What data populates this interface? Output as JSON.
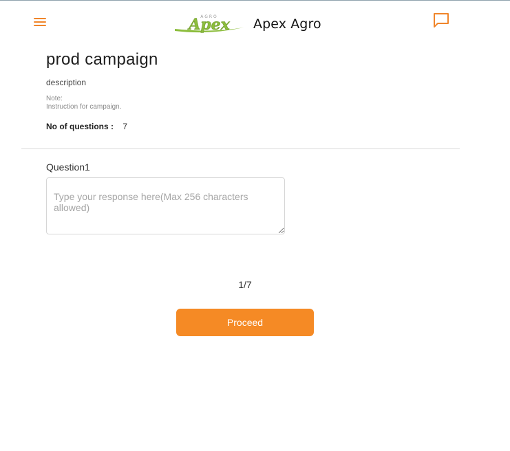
{
  "header": {
    "menu_icon": "menu-icon",
    "chat_icon": "chat-icon",
    "logo_text": "Apex",
    "logo_small_text": "AGRO",
    "app_name": "Apex Agro"
  },
  "campaign": {
    "title": "prod campaign",
    "description": "description",
    "note_label": "Note:",
    "note_text": "Instruction for campaign.",
    "questions_label": "No of questions :",
    "questions_count": "7"
  },
  "question": {
    "label": "Question1",
    "value": "",
    "placeholder": "Type your response here(Max 256 characters allowed)"
  },
  "pager": {
    "text": "1/7"
  },
  "actions": {
    "proceed_label": "Proceed"
  },
  "colors": {
    "accent": "#f58a25",
    "logo_green": "#8cbd3c"
  }
}
